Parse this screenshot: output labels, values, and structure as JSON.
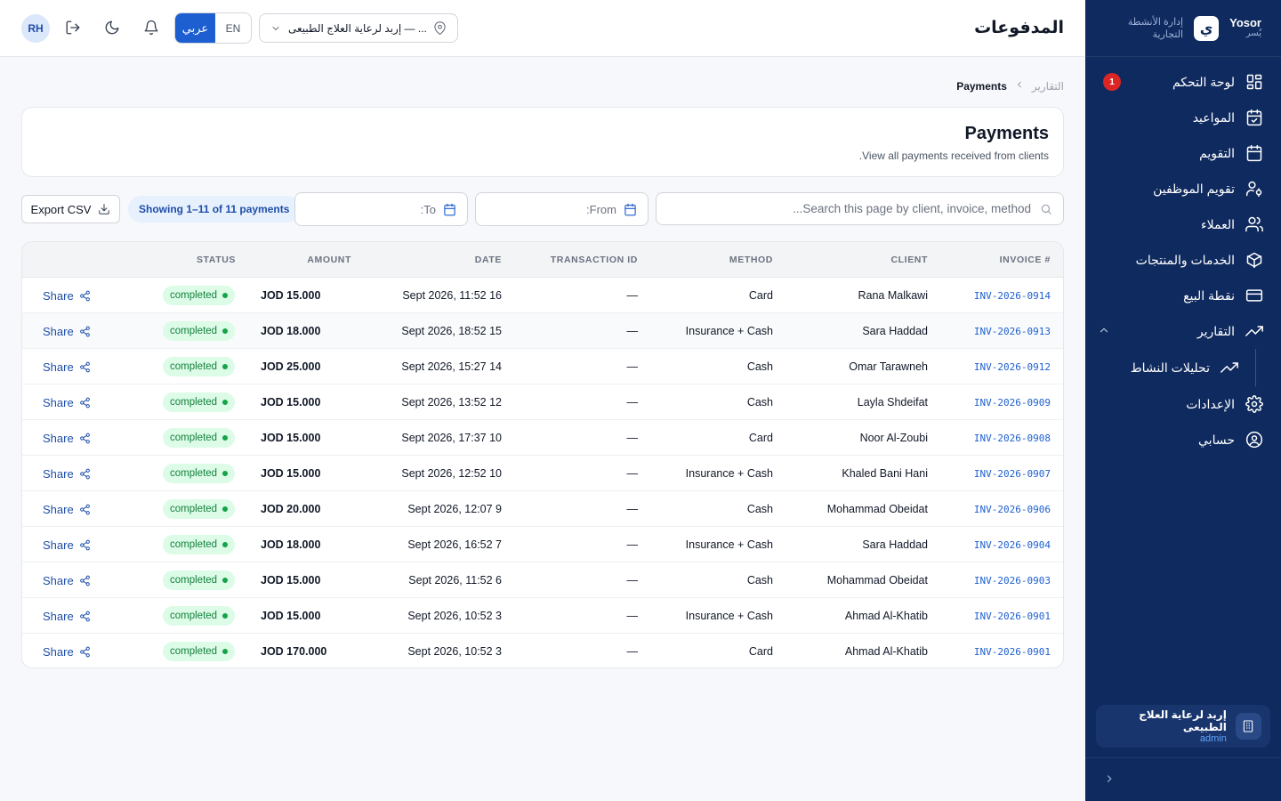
{
  "sidebar": {
    "brand_en": "Yosor",
    "brand_ar": "يُسر",
    "brand_logo": "ي",
    "brand_sub_1": "إدارة الأنشطة",
    "brand_sub_2": "التجارية",
    "items": [
      {
        "label": "لوحة التحكم",
        "icon": "dashboard-icon",
        "badge": "1"
      },
      {
        "label": "المواعيد",
        "icon": "calendar-check-icon"
      },
      {
        "label": "التقويم",
        "icon": "calendar-icon"
      },
      {
        "label": "تقويم الموظفين",
        "icon": "user-cog-icon"
      },
      {
        "label": "العملاء",
        "icon": "users-icon"
      },
      {
        "label": "الخدمات والمنتجات",
        "icon": "package-icon"
      },
      {
        "label": "نقطة البيع",
        "icon": "credit-card-icon"
      },
      {
        "label": "التقارير",
        "icon": "trending-up-icon",
        "expanded": true
      },
      {
        "label": "تحليلات النشاط",
        "icon": "trending-up-icon",
        "sub": true
      },
      {
        "label": "الإعدادات",
        "icon": "gear-icon"
      },
      {
        "label": "حسابي",
        "icon": "user-circle-icon"
      }
    ],
    "clinic_name": "إربد لرعاية العلاج الطبيعى",
    "clinic_role": "admin"
  },
  "topbar": {
    "title": "المدفوعات",
    "avatar": "RH",
    "lang_ar": "عربي",
    "lang_en": "EN",
    "branch": "إربد لرعاية العلاج الطبيعى — ..."
  },
  "breadcrumb": {
    "parent": "التقارير",
    "current": "Payments"
  },
  "header": {
    "title": "Payments",
    "subtitle": ".View all payments received from clients"
  },
  "filters": {
    "search_placeholder": "...Search this page by client, invoice, method",
    "from_label": ":From",
    "to_label": ":To",
    "showing": "Showing 1–11 of 11 payments",
    "export_label": "Export CSV"
  },
  "table": {
    "headers": {
      "invoice": "INVOICE #",
      "client": "CLIENT",
      "method": "METHOD",
      "txn": "TRANSACTION ID",
      "date": "DATE",
      "amount": "AMOUNT",
      "status": "STATUS"
    },
    "share_label": "Share",
    "rows": [
      {
        "invoice": "INV-2026-0914",
        "client": "Rana Malkawi",
        "method": "Card",
        "txn": "—",
        "date": "Sept 2026, 11:52 16",
        "amount": "JOD 15.000",
        "status": "completed"
      },
      {
        "invoice": "INV-2026-0913",
        "client": "Sara Haddad",
        "method": "Insurance + Cash",
        "txn": "—",
        "date": "Sept 2026, 18:52 15",
        "amount": "JOD 18.000",
        "status": "completed"
      },
      {
        "invoice": "INV-2026-0912",
        "client": "Omar Tarawneh",
        "method": "Cash",
        "txn": "—",
        "date": "Sept 2026, 15:27 14",
        "amount": "JOD 25.000",
        "status": "completed"
      },
      {
        "invoice": "INV-2026-0909",
        "client": "Layla Shdeifat",
        "method": "Cash",
        "txn": "—",
        "date": "Sept 2026, 13:52 12",
        "amount": "JOD 15.000",
        "status": "completed"
      },
      {
        "invoice": "INV-2026-0908",
        "client": "Noor Al-Zoubi",
        "method": "Card",
        "txn": "—",
        "date": "Sept 2026, 17:37 10",
        "amount": "JOD 15.000",
        "status": "completed"
      },
      {
        "invoice": "INV-2026-0907",
        "client": "Khaled Bani Hani",
        "method": "Insurance + Cash",
        "txn": "—",
        "date": "Sept 2026, 12:52 10",
        "amount": "JOD 15.000",
        "status": "completed"
      },
      {
        "invoice": "INV-2026-0906",
        "client": "Mohammad Obeidat",
        "method": "Cash",
        "txn": "—",
        "date": "Sept 2026, 12:07 9",
        "amount": "JOD 20.000",
        "status": "completed"
      },
      {
        "invoice": "INV-2026-0904",
        "client": "Sara Haddad",
        "method": "Insurance + Cash",
        "txn": "—",
        "date": "Sept 2026, 16:52 7",
        "amount": "JOD 18.000",
        "status": "completed"
      },
      {
        "invoice": "INV-2026-0903",
        "client": "Mohammad Obeidat",
        "method": "Cash",
        "txn": "—",
        "date": "Sept 2026, 11:52 6",
        "amount": "JOD 15.000",
        "status": "completed"
      },
      {
        "invoice": "INV-2026-0901",
        "client": "Ahmad Al-Khatib",
        "method": "Insurance + Cash",
        "txn": "—",
        "date": "Sept 2026, 10:52 3",
        "amount": "JOD 15.000",
        "status": "completed"
      },
      {
        "invoice": "INV-2026-0901",
        "client": "Ahmad Al-Khatib",
        "method": "Card",
        "txn": "—",
        "date": "Sept 2026, 10:52 3",
        "amount": "JOD 170.000",
        "status": "completed"
      }
    ]
  },
  "colors": {
    "sidebar_bg": "#0f2a5e",
    "accent": "#1d5fd0",
    "status_completed_bg": "#dcfce7",
    "status_completed_fg": "#15803d",
    "badge": "#dc2626"
  }
}
